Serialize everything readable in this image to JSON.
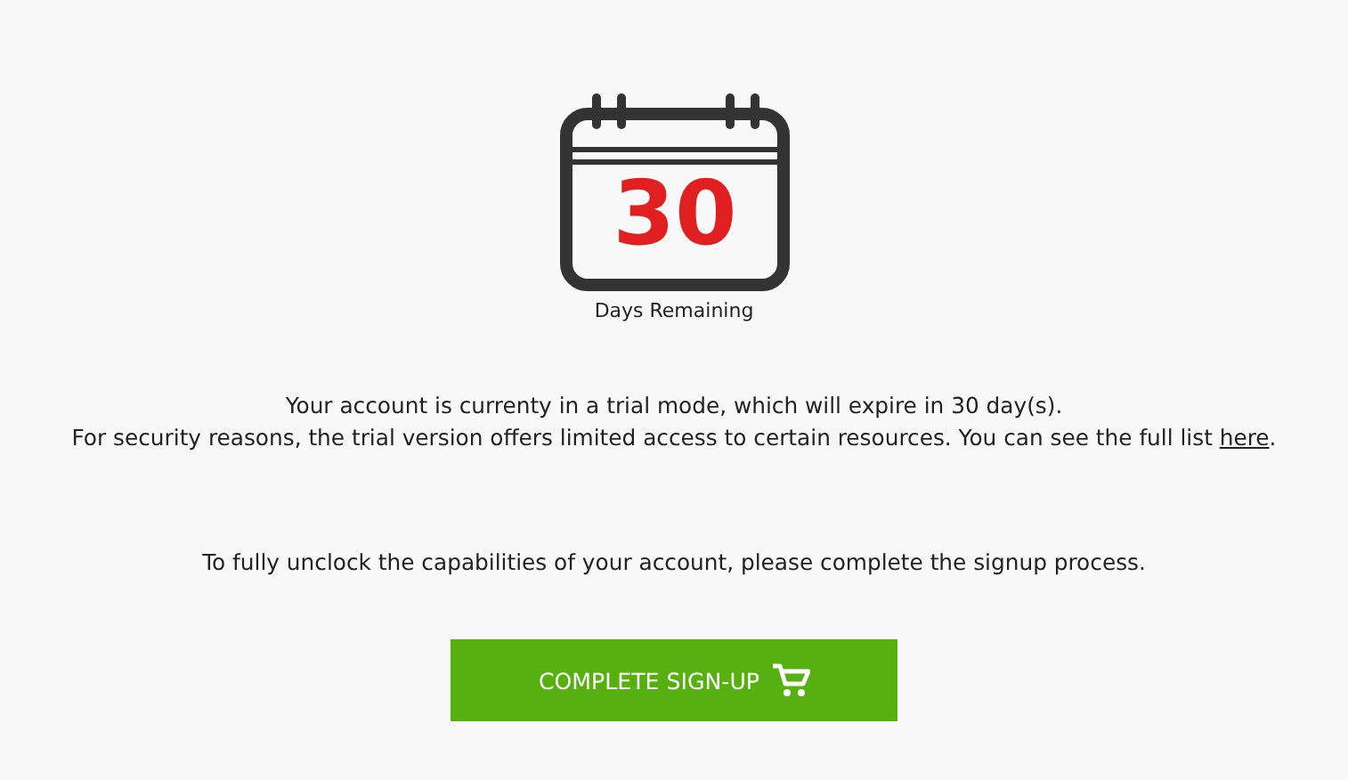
{
  "trial": {
    "days": "30",
    "caption": "Days Remaining"
  },
  "messages": [
    "Your account is currenty in a trial mode, which will expire in 30 day(s).",
    "For security reasons, the trial version offers limited access to certain resources. You can see the full list "
  ],
  "link": "here",
  "link_suffix": ".",
  "prompt": "To fully unclock the capabilities of your account, please complete the signup process.",
  "button": {
    "label": "COMPLETE SIGN-UP"
  }
}
